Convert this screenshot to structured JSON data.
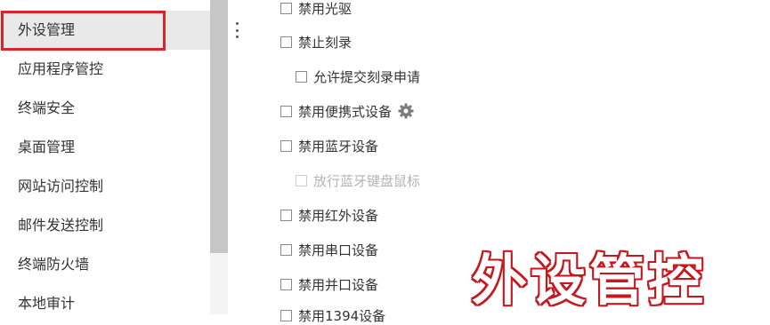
{
  "sidebar": {
    "items": [
      {
        "label": "外设管理"
      },
      {
        "label": "应用程序管控"
      },
      {
        "label": "终端安全"
      },
      {
        "label": "桌面管理"
      },
      {
        "label": "网站访问控制"
      },
      {
        "label": "邮件发送控制"
      },
      {
        "label": "终端防火墙"
      },
      {
        "label": "本地审计"
      }
    ]
  },
  "options": [
    {
      "label": "禁用光驱",
      "checked": false,
      "disabled": false
    },
    {
      "label": "禁止刻录",
      "checked": false,
      "disabled": false
    },
    {
      "label": "允许提交刻录申请",
      "checked": false,
      "disabled": false
    },
    {
      "label": "禁用便携式设备",
      "checked": false,
      "disabled": false,
      "icon": "gear-icon"
    },
    {
      "label": "禁用蓝牙设备",
      "checked": false,
      "disabled": false
    },
    {
      "label": "放行蓝牙键盘鼠标",
      "checked": false,
      "disabled": true
    },
    {
      "label": "禁用红外设备",
      "checked": false,
      "disabled": false
    },
    {
      "label": "禁用串口设备",
      "checked": false,
      "disabled": false
    },
    {
      "label": "禁用并口设备",
      "checked": false,
      "disabled": false
    },
    {
      "label": "禁用1394设备",
      "checked": false,
      "disabled": false
    }
  ],
  "watermark": {
    "text": "外设管控"
  },
  "colors": {
    "highlight_border": "#d9232d",
    "active_bg": "#e9e9e9",
    "watermark": "#c9161d",
    "disabled_text": "#b3b3b3"
  }
}
